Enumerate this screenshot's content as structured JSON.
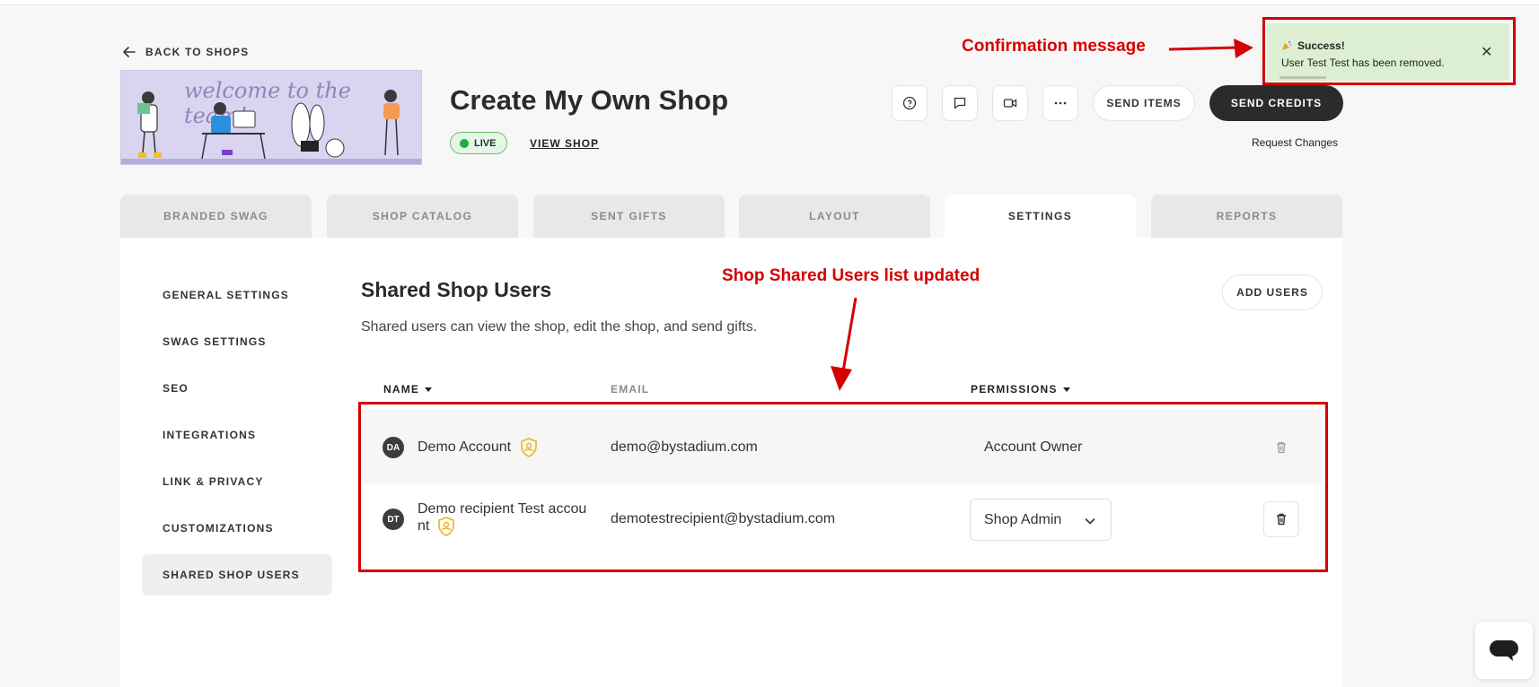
{
  "back_label": "BACK TO SHOPS",
  "banner": {
    "script_text": "welcome to the team!"
  },
  "shop": {
    "title": "Create My Own Shop",
    "status": "LIVE",
    "view_label": "VIEW SHOP"
  },
  "header_actions": {
    "icons": [
      "help-circle-icon",
      "chat-icon",
      "video-icon",
      "more-dots-icon"
    ],
    "send_items": "SEND ITEMS",
    "send_credits": "SEND CREDITS",
    "request_changes": "Request Changes"
  },
  "toast": {
    "title": "Success!",
    "message": "User Test Test has been removed.",
    "icon": "party-popper-icon"
  },
  "annotations": {
    "confirmation": "Confirmation message",
    "list_updated": "Shop Shared Users list updated",
    "color": "#d40000"
  },
  "tabs": [
    "BRANDED SWAG",
    "SHOP CATALOG",
    "SENT GIFTS",
    "LAYOUT",
    "SETTINGS",
    "REPORTS"
  ],
  "active_tab": "SETTINGS",
  "sidebar": [
    "GENERAL SETTINGS",
    "SWAG SETTINGS",
    "SEO",
    "INTEGRATIONS",
    "LINK & PRIVACY",
    "CUSTOMIZATIONS",
    "SHARED SHOP USERS"
  ],
  "active_sidebar": "SHARED SHOP USERS",
  "section": {
    "title": "Shared Shop Users",
    "description": "Shared users can view the shop, edit the shop, and send gifts.",
    "add_users": "ADD USERS"
  },
  "table": {
    "headers": {
      "name": "NAME",
      "email": "EMAIL",
      "permissions": "PERMISSIONS"
    },
    "rows": [
      {
        "initials": "DA",
        "name": "Demo Account",
        "email": "demo@bystadium.com",
        "permission": "Account Owner"
      },
      {
        "initials": "DT",
        "name_line1": "Demo recipient Test accou",
        "name_line2": "nt",
        "email": "demotestrecipient@bystadium.com",
        "permission": "Shop Admin"
      }
    ]
  },
  "colors": {
    "accent_dark": "#2b2b2b",
    "live_green": "#1fae3b",
    "toast_bg": "#dcefd3",
    "shield": "#f2b21c"
  }
}
